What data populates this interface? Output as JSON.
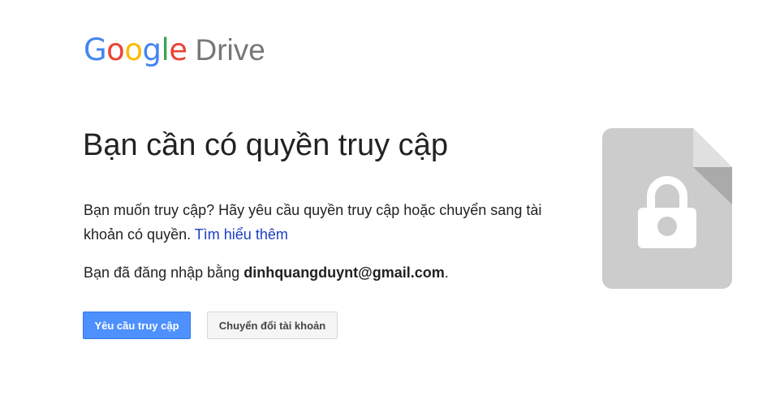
{
  "logo": {
    "letters": [
      {
        "char": "G",
        "color": "#4285F4"
      },
      {
        "char": "o",
        "color": "#EA4335"
      },
      {
        "char": "o",
        "color": "#FBBC05"
      },
      {
        "char": "g",
        "color": "#4285F4"
      },
      {
        "char": "l",
        "color": "#34A853"
      },
      {
        "char": "e",
        "color": "#EA4335"
      }
    ],
    "product": "Drive"
  },
  "main": {
    "title": "Bạn cần có quyền truy cập",
    "description": "Bạn muốn truy cập? Hãy yêu cầu quyền truy cập hoặc chuyển sang tài khoản có quyền.",
    "learn_more_link": "Tìm hiểu thêm",
    "signed_in_prefix": "Bạn đã đăng nhập bằng",
    "email": "dinhquangduynt@gmail.com",
    "signed_in_suffix": "."
  },
  "actions": {
    "request_access_label": "Yêu cầu truy cập",
    "switch_account_label": "Chuyển đổi tài khoản"
  },
  "illustration": {
    "icon": "locked-file-icon",
    "colors": {
      "body": "#CCCCCC",
      "fold": "#E0E0E0",
      "fold_shadow": "#AAAAAA",
      "lock": "#FFFFFF"
    }
  },
  "colors": {
    "primary_button": "#4D90FE",
    "link": "#1A3EC4"
  }
}
